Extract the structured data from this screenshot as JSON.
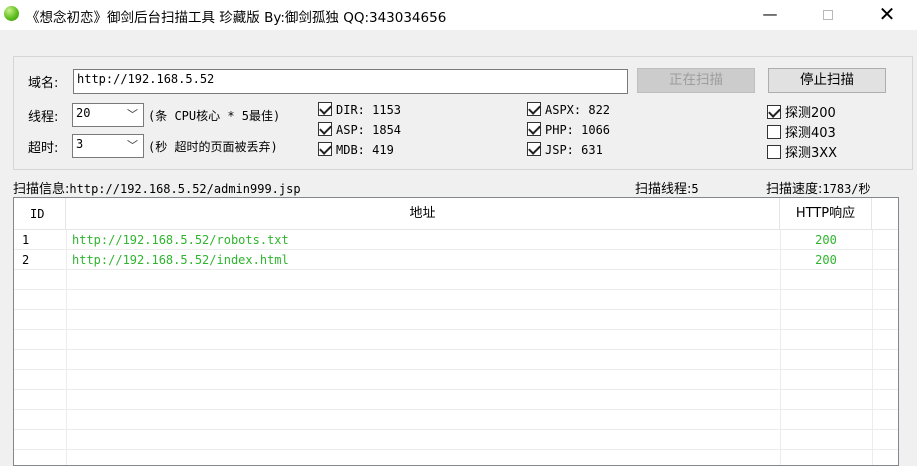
{
  "window": {
    "title": "《想念初恋》御剑后台扫描工具 珍藏版 By:御剑孤独 QQ:343034656",
    "minimize_glyph": "—",
    "close_glyph": "✕"
  },
  "form": {
    "domain_label": "域名:",
    "domain_value": "http://192.168.5.52",
    "threads_label": "线程:",
    "threads_value": "20",
    "threads_hint": "(条 CPU核心 * 5最佳)",
    "timeout_label": "超时:",
    "timeout_value": "3",
    "timeout_hint": "(秒 超时的页面被丢弃)",
    "scan_button": "正在扫描",
    "stop_button": "停止扫描"
  },
  "dictionaries": [
    {
      "label": "DIR: 1153",
      "checked": true
    },
    {
      "label": "ASP: 1854",
      "checked": true
    },
    {
      "label": "MDB: 419",
      "checked": true
    },
    {
      "label": "ASPX: 822",
      "checked": true
    },
    {
      "label": "PHP: 1066",
      "checked": true
    },
    {
      "label": "JSP: 631",
      "checked": true
    }
  ],
  "probes": [
    {
      "label": "探测200",
      "checked": true
    },
    {
      "label": "探测403",
      "checked": false
    },
    {
      "label": "探测3XX",
      "checked": false
    }
  ],
  "status": {
    "info_label": "扫描信息:",
    "info_value": "http://192.168.5.52/admin999.jsp",
    "threads_label": "扫描线程:",
    "threads_value": "5",
    "speed_label": "扫描速度:",
    "speed_value": "1783/秒"
  },
  "table": {
    "headers": [
      "ID",
      "地址",
      "HTTP响应"
    ],
    "rows": [
      {
        "id": "1",
        "url": "http://192.168.5.52/robots.txt",
        "code": "200"
      },
      {
        "id": "2",
        "url": "http://192.168.5.52/index.html",
        "code": "200"
      }
    ]
  }
}
